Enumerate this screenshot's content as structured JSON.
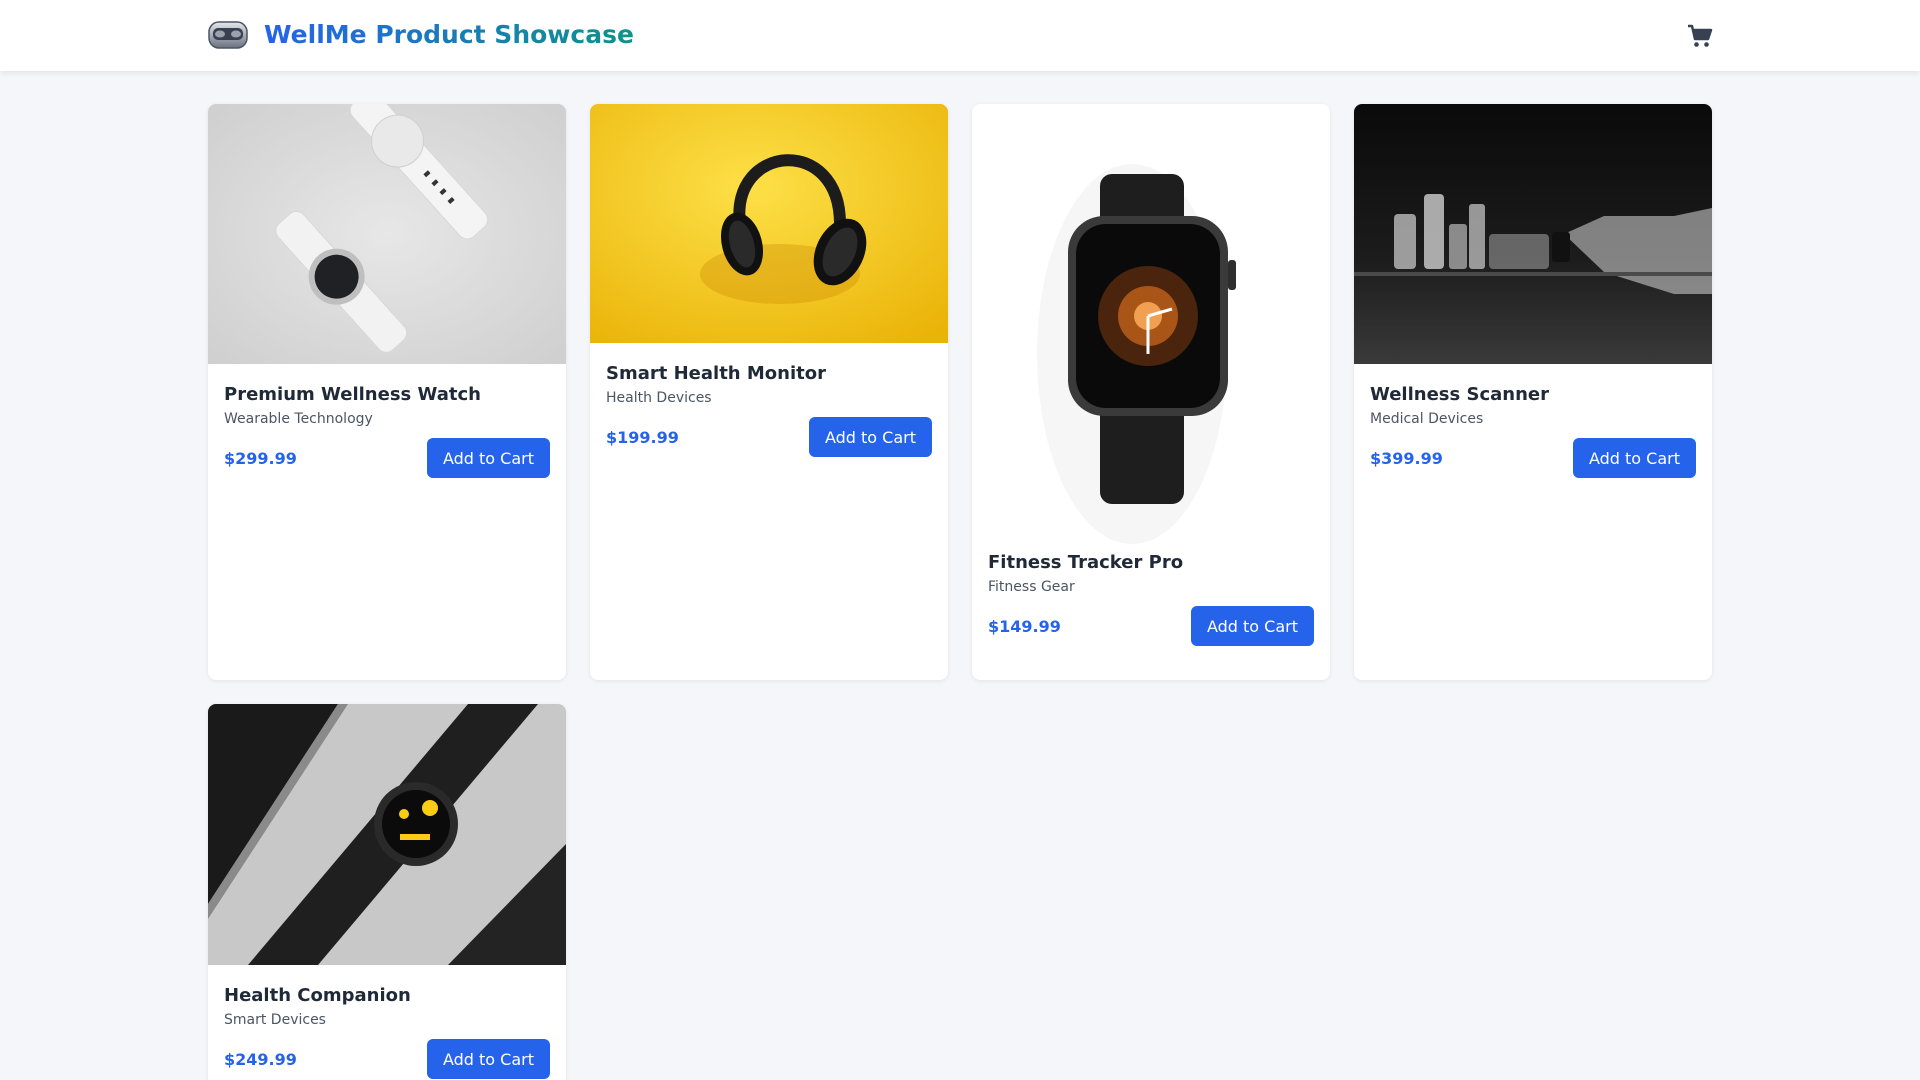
{
  "header": {
    "title": "WellMe Product Showcase",
    "logo_icon": "vr-headset-icon",
    "cart_icon": "shopping-cart-icon"
  },
  "products": [
    {
      "name": "Premium Wellness Watch",
      "category": "Wearable Technology",
      "price": "$299.99",
      "button": "Add to Cart",
      "image": "white smartwatches on grey background"
    },
    {
      "name": "Smart Health Monitor",
      "category": "Health Devices",
      "price": "$199.99",
      "button": "Add to Cart",
      "image": "black headphones on yellow background"
    },
    {
      "name": "Fitness Tracker Pro",
      "category": "Fitness Gear",
      "price": "$149.99",
      "button": "Add to Cart",
      "image": "black smartwatch on white background"
    },
    {
      "name": "Wellness Scanner",
      "category": "Medical Devices",
      "price": "$399.99",
      "button": "Add to Cart",
      "image": "glass vials on dark background"
    },
    {
      "name": "Health Companion",
      "category": "Smart Devices",
      "price": "$249.99",
      "button": "Add to Cart",
      "image": "black round smartwatch beside tablet"
    }
  ],
  "colors": {
    "accent": "#2563eb",
    "brand_gradient_end": "#0d9488",
    "background": "#f4f6f9"
  }
}
